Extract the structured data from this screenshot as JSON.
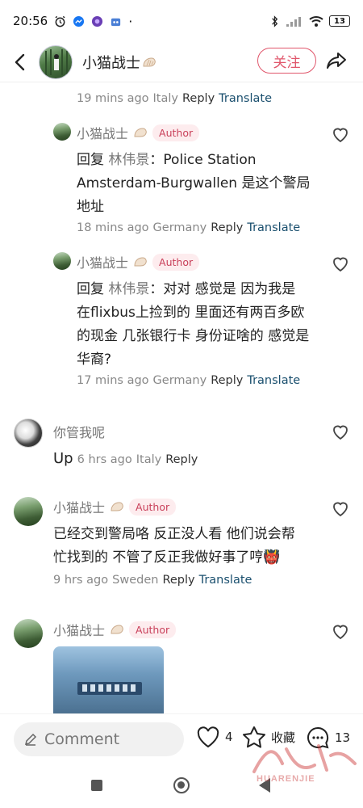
{
  "status_bar": {
    "time": "20:56",
    "battery": "13"
  },
  "header": {
    "username": "小猫战士",
    "follow_label": "关注"
  },
  "comments": [
    {
      "meta": {
        "time": "19 mins ago",
        "location": "Italy",
        "reply": "Reply",
        "translate": "Translate"
      }
    },
    {
      "username": "小猫战士",
      "author_tag": "Author",
      "prefix": "回复",
      "mention": "林伟景",
      "colon": "：",
      "lines": [
        "Police Station",
        "Amsterdam-Burgwallen 是这个警局",
        "地址"
      ],
      "meta": {
        "time": "18 mins ago",
        "location": "Germany",
        "reply": "Reply",
        "translate": "Translate"
      }
    },
    {
      "username": "小猫战士",
      "author_tag": "Author",
      "prefix": "回复",
      "mention": "林伟景",
      "colon": "：",
      "lines": [
        "对对 感觉是 因为我是",
        "在flixbus上捡到的 里面还有两百多欧",
        "的现金 几张银行卡 身份证啥的 感觉是",
        "华裔?"
      ],
      "meta": {
        "time": "17 mins ago",
        "location": "Germany",
        "reply": "Reply",
        "translate": "Translate"
      }
    },
    {
      "username": "你管我呢",
      "text": "Up",
      "meta": {
        "time": "6 hrs ago",
        "location": "Italy",
        "reply": "Reply"
      }
    },
    {
      "username": "小猫战士",
      "author_tag": "Author",
      "lines": [
        "已经交到警局咯 反正没人看 他们说会帮",
        "忙找到的 不管了反正我做好事了哼"
      ],
      "emoji": "👹",
      "meta": {
        "time": "9 hrs ago",
        "location": "Sweden",
        "reply": "Reply",
        "translate": "Translate"
      }
    },
    {
      "username": "小猫战士",
      "author_tag": "Author"
    }
  ],
  "bottom_bar": {
    "comment_placeholder": "Comment",
    "likes": "4",
    "favorite_label": "收藏",
    "comments_count": "13"
  },
  "watermark": {
    "text": "华人街",
    "latin": "HUARENJIE"
  }
}
